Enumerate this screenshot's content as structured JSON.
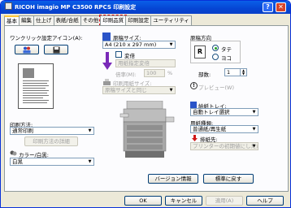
{
  "window": {
    "title": "RICOH imagio MP C3500 RPCS 印刷設定"
  },
  "tabs": [
    {
      "label": "基本"
    },
    {
      "label": "編集"
    },
    {
      "label": "仕上げ"
    },
    {
      "label": "表紙/合紙"
    },
    {
      "label": "その他"
    },
    {
      "label": "印刷品質"
    },
    {
      "label": "印刷設定"
    },
    {
      "label": "ユーティリティ"
    }
  ],
  "oneclick": {
    "label": "ワンクリック設定アイコン(A):"
  },
  "paper_size": {
    "label": "原稿サイズ:",
    "value": "A4 (210 x 297 mm)"
  },
  "scale": {
    "label": "変倍"
  },
  "paper_to_output": {
    "value": "用紙指定変倍"
  },
  "magnification": {
    "label": "倍率(M):",
    "value": "100"
  },
  "print_size": {
    "label": "印刷用紙サイズ:",
    "value": "原稿サイズと同じ"
  },
  "orientation": {
    "label": "原稿方向",
    "portrait": "タテ",
    "landscape": "ヨコ"
  },
  "copies": {
    "label": "部数:",
    "value": "1"
  },
  "duplex_preview": {
    "label": "プレビュー(W)"
  },
  "tray": {
    "label": "給紙トレイ:",
    "value": "自動トレイ選択"
  },
  "paper_type": {
    "label": "用紙種類:",
    "value": "普通紙/再生紙"
  },
  "output": {
    "label": "排紙先:",
    "value": "プリンターの初期値にしたがう"
  },
  "print_method": {
    "label": "印刷方法:",
    "value": "通常印刷",
    "detail_button": "印刷方法の詳細"
  },
  "color_mode": {
    "label": "カラー/白黒:",
    "value": "白黒"
  },
  "buttons": {
    "version": "バージョン情報",
    "restore": "標準に戻す",
    "ok": "OK",
    "cancel": "キャンセル",
    "apply": "適用(A)",
    "help": "ヘルプ"
  }
}
